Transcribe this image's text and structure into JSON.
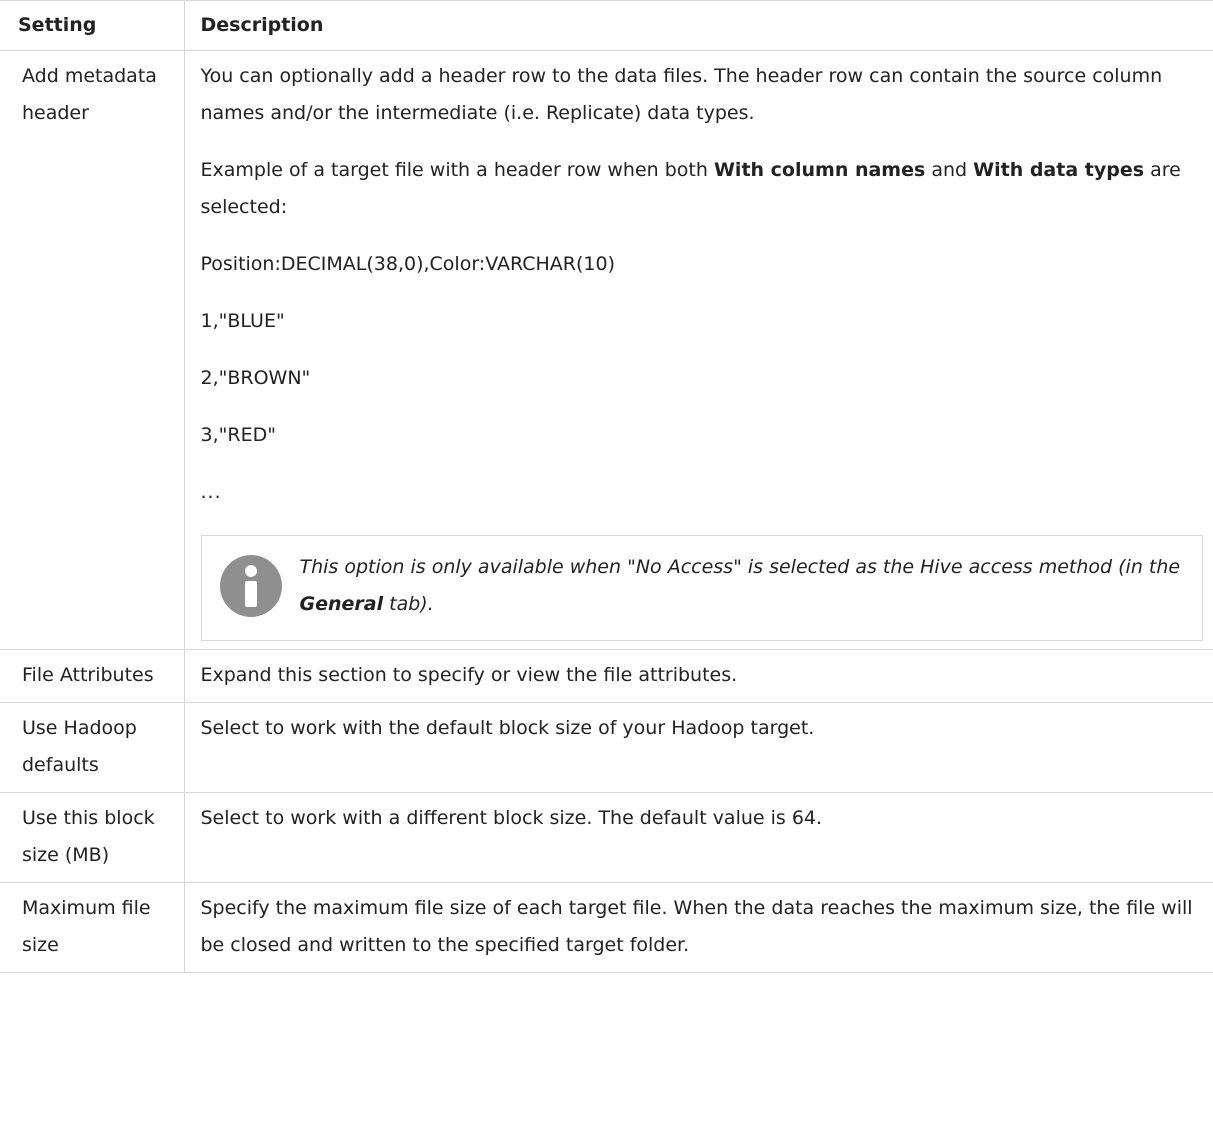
{
  "table": {
    "header": {
      "setting": "Setting",
      "description": "Description"
    },
    "rows": [
      {
        "setting": "Add metadata header",
        "description": {
          "intro": "You can optionally add a header row to the data files. The header row can contain the source column names and/or the intermediate (i.e. Replicate) data types.",
          "example_pre": "Example of a target file with a header row when both ",
          "example_bold1": "With column names",
          "example_mid": " and ",
          "example_bold2": "With data types",
          "example_post": " are selected:",
          "lines": [
            "Position:DECIMAL(38,0),Color:VARCHAR(10)",
            "1,\"BLUE\"",
            "2,\"BROWN\"",
            "3,\"RED\"",
            "..."
          ],
          "note": {
            "icon": "info-icon",
            "pre": "This option is only available when \"No Access\" is selected as the Hive access method (in the ",
            "bold": "General",
            "post": " tab)."
          }
        }
      },
      {
        "setting": "File Attributes",
        "description": "Expand this section to specify or view the file attributes."
      },
      {
        "setting": "Use Hadoop defaults",
        "description": "Select to work with the default block size of your Hadoop target."
      },
      {
        "setting": "Use this block size (MB)",
        "description": "Select to work with a different block size. The default value is 64."
      },
      {
        "setting": "Maximum file size",
        "description": "Specify the maximum file size of each target file. When the data reaches the maximum size, the file will be closed and written to the specified target folder."
      }
    ]
  },
  "colors": {
    "text": "#222222",
    "border": "#d6d6d6",
    "icon": "#8f8f8f"
  }
}
